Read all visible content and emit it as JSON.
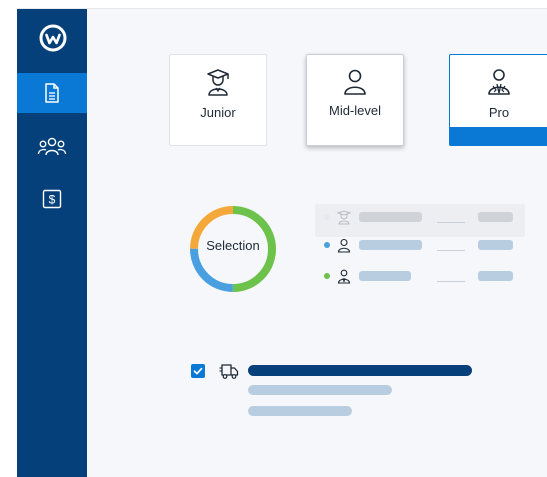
{
  "colors": {
    "sidebar": "#05407a",
    "sidebar_active": "#0a79d6",
    "accent": "#0a79d6",
    "donut_green": "#6cc24a",
    "donut_blue": "#4a9fe0",
    "donut_orange": "#f5a83a",
    "placeholder_blue": "#b9cde0",
    "placeholder_gray": "#cfd3d8",
    "task_bar_dark": "#05407a"
  },
  "sidebar": {
    "logo": "brand-w-logo-icon",
    "items": [
      {
        "name": "documents",
        "icon": "document-icon",
        "active": true
      },
      {
        "name": "people",
        "icon": "group-icon",
        "active": false
      },
      {
        "name": "payments",
        "icon": "dollar-icon",
        "active": false
      }
    ]
  },
  "levels": [
    {
      "label": "Junior",
      "icon": "graduate-icon"
    },
    {
      "label": "Mid-level",
      "icon": "person-icon"
    },
    {
      "label": "Pro",
      "icon": "executive-icon"
    }
  ],
  "selection": {
    "label": "Selection",
    "legend": [
      {
        "icon": "graduate-icon",
        "dot_color": "#e6e9ee"
      },
      {
        "icon": "person-icon",
        "dot_color": "#4a9fe0"
      },
      {
        "icon": "executive-icon",
        "dot_color": "#6cc24a"
      }
    ]
  },
  "task": {
    "checked": true,
    "icon": "delivery-truck-icon"
  }
}
